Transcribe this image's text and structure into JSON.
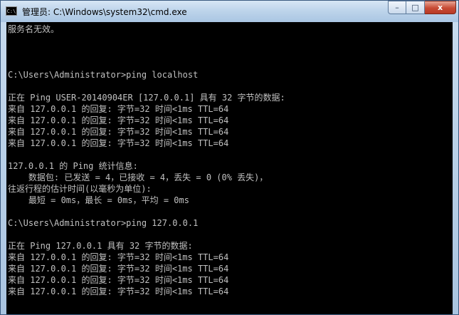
{
  "window": {
    "title": "管理员: C:\\Windows\\system32\\cmd.exe",
    "icon_text": "C:\\",
    "buttons": {
      "minimize": "–",
      "maximize": "□",
      "close": "x"
    }
  },
  "console": {
    "lines": [
      "服务名无效。",
      "",
      "",
      "",
      "C:\\Users\\Administrator>ping localhost",
      "",
      "正在 Ping USER-20140904ER [127.0.0.1] 具有 32 字节的数据:",
      "来自 127.0.0.1 的回复: 字节=32 时间<1ms TTL=64",
      "来自 127.0.0.1 的回复: 字节=32 时间<1ms TTL=64",
      "来自 127.0.0.1 的回复: 字节=32 时间<1ms TTL=64",
      "来自 127.0.0.1 的回复: 字节=32 时间<1ms TTL=64",
      "",
      "127.0.0.1 的 Ping 统计信息:",
      "    数据包: 已发送 = 4，已接收 = 4，丢失 = 0 (0% 丢失)，",
      "往返行程的估计时间(以毫秒为单位):",
      "    最短 = 0ms，最长 = 0ms，平均 = 0ms",
      "",
      "C:\\Users\\Administrator>ping 127.0.0.1",
      "",
      "正在 Ping 127.0.0.1 具有 32 字节的数据:",
      "来自 127.0.0.1 的回复: 字节=32 时间<1ms TTL=64",
      "来自 127.0.0.1 的回复: 字节=32 时间<1ms TTL=64",
      "来自 127.0.0.1 的回复: 字节=32 时间<1ms TTL=64",
      "来自 127.0.0.1 的回复: 字节=32 时间<1ms TTL=64"
    ]
  }
}
